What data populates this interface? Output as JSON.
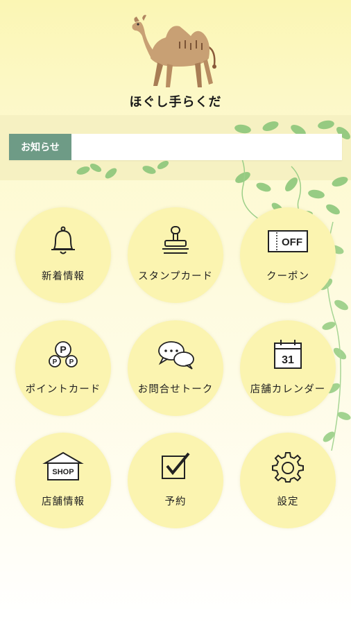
{
  "header": {
    "app_name": "ほぐし手らくだ"
  },
  "notice": {
    "label": "お知らせ",
    "text": ""
  },
  "menu": [
    {
      "label": "新着情報",
      "icon": "bell-icon"
    },
    {
      "label": "スタンプカード",
      "icon": "stamp-icon"
    },
    {
      "label": "クーポン",
      "icon": "coupon-icon",
      "icon_text": "OFF"
    },
    {
      "label": "ポイントカード",
      "icon": "point-card-icon",
      "icon_text": "P"
    },
    {
      "label": "お問合せトーク",
      "icon": "chat-bubbles-icon"
    },
    {
      "label": "店舗カレンダー",
      "icon": "calendar-icon",
      "icon_text": "31"
    },
    {
      "label": "店舗情報",
      "icon": "shop-icon",
      "icon_text": "SHOP"
    },
    {
      "label": "予約",
      "icon": "checkbox-icon"
    },
    {
      "label": "設定",
      "icon": "gear-icon"
    }
  ],
  "colors": {
    "background": "#fbf6b4",
    "button": "#fbf4b0",
    "notice_label_bg": "#6e9b86",
    "leaf_green": "#7fbf6a"
  }
}
